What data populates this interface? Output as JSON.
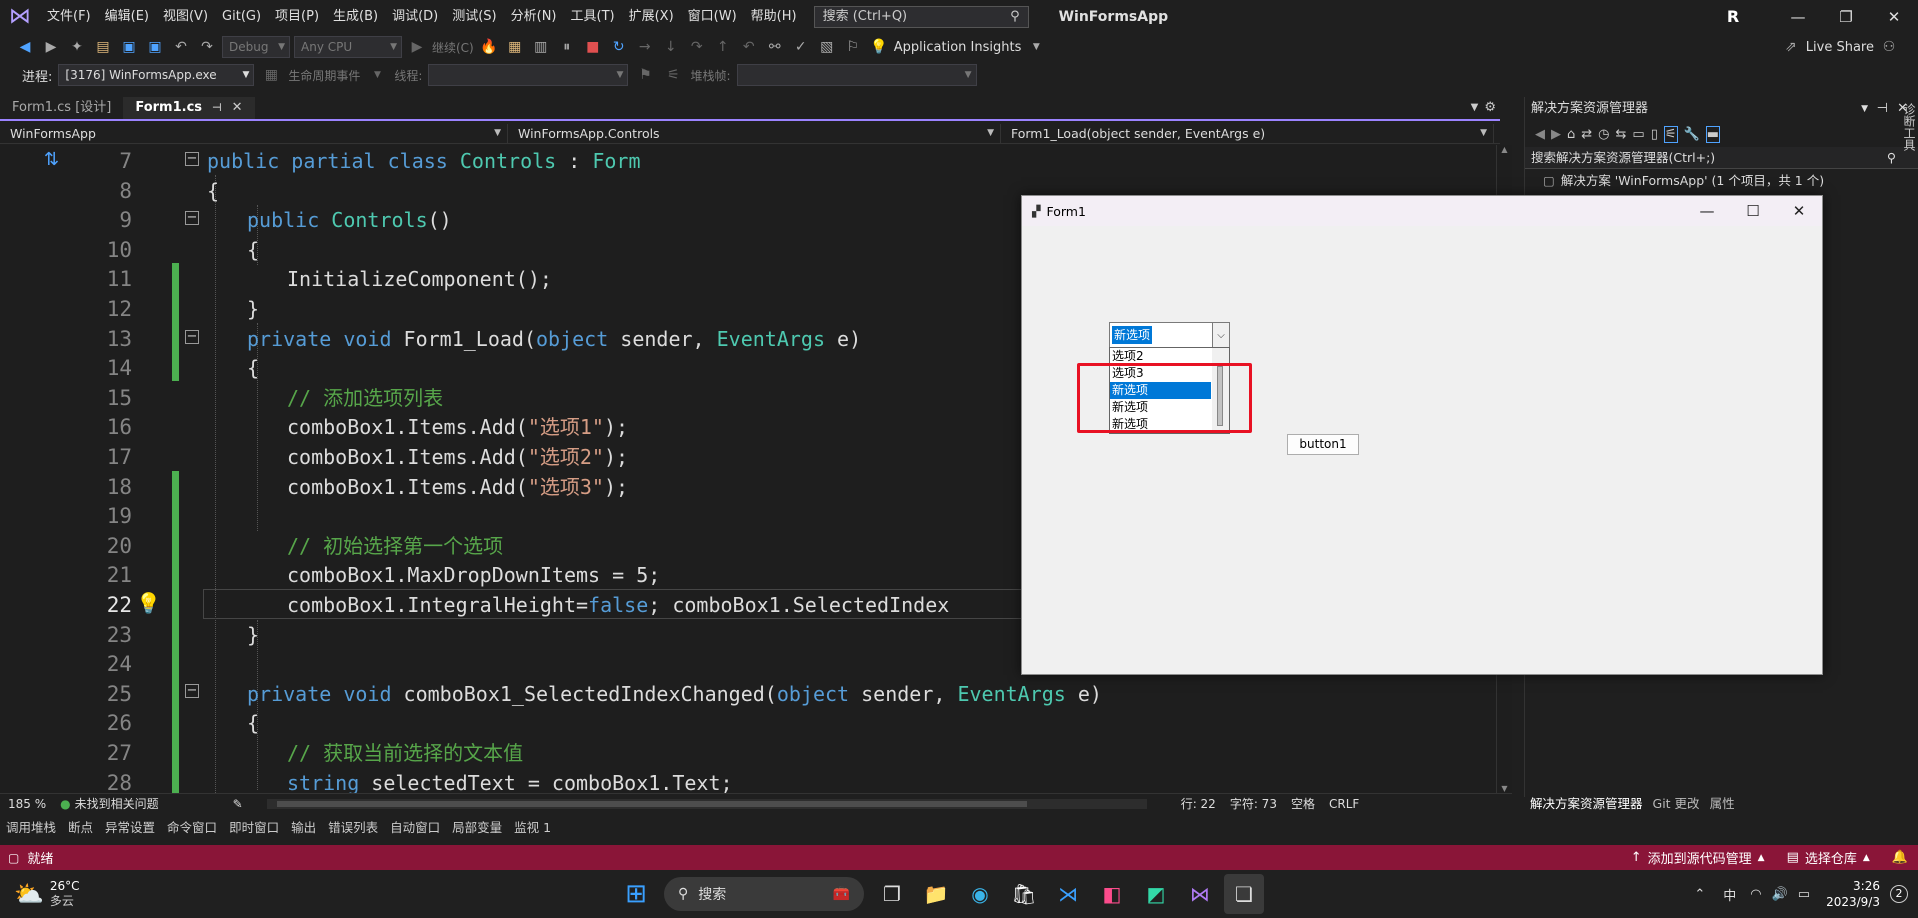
{
  "menubar": {
    "items": [
      "文件(F)",
      "编辑(E)",
      "视图(V)",
      "Git(G)",
      "项目(P)",
      "生成(B)",
      "调试(D)",
      "测试(S)",
      "分析(N)",
      "工具(T)",
      "扩展(X)",
      "窗口(W)",
      "帮助(H)"
    ],
    "search_placeholder": "搜索 (Ctrl+Q)",
    "app_title": "WinFormsApp",
    "user_initial": "R"
  },
  "toolbar1": {
    "config": "Debug",
    "platform": "Any CPU",
    "continue_label": "继续(C)",
    "app_insights": "Application Insights",
    "live_share": "Live Share"
  },
  "toolbar2": {
    "process_label": "进程:",
    "process_value": "[3176] WinFormsApp.exe",
    "lifecycle": "生命周期事件",
    "thread_label": "线程:",
    "stackframe_label": "堆栈帧:"
  },
  "tabs": [
    {
      "label": "Form1.cs [设计]"
    },
    {
      "label": "Form1.cs"
    }
  ],
  "navbar": {
    "project": "WinFormsApp",
    "class": "WinFormsApp.Controls",
    "member": "Form1_Load(object sender, EventArgs e)"
  },
  "editor": {
    "lines": [
      {
        "num": "7"
      },
      {
        "num": "8"
      },
      {
        "num": "9"
      },
      {
        "num": "10"
      },
      {
        "num": "11"
      },
      {
        "num": "12"
      },
      {
        "num": "13"
      },
      {
        "num": "14"
      },
      {
        "num": "15"
      },
      {
        "num": "16"
      },
      {
        "num": "17"
      },
      {
        "num": "18"
      },
      {
        "num": "19"
      },
      {
        "num": "20"
      },
      {
        "num": "21"
      },
      {
        "num": "22"
      },
      {
        "num": "23"
      },
      {
        "num": "24"
      },
      {
        "num": "25"
      },
      {
        "num": "26"
      },
      {
        "num": "27"
      },
      {
        "num": "28"
      }
    ],
    "code": {
      "l7": [
        "public partial class ",
        "Controls",
        " : ",
        "Form"
      ],
      "l8": "{",
      "l9": [
        "public ",
        "Controls",
        "()"
      ],
      "l10": "{",
      "l11": "InitializeComponent();",
      "l12": "}",
      "l13": [
        "private void ",
        "Form1_Load(",
        "object",
        " sender, ",
        "EventArgs",
        " e)"
      ],
      "l14": "{",
      "l15": "// 添加选项列表",
      "l16": [
        "comboBox1.Items.Add(",
        "\"选项1\"",
        ");"
      ],
      "l17": [
        "comboBox1.Items.Add(",
        "\"选项2\"",
        ");"
      ],
      "l18": [
        "comboBox1.Items.Add(",
        "\"选项3\"",
        ");"
      ],
      "l20": "// 初始选择第一个选项",
      "l21": "comboBox1.MaxDropDownItems = 5;",
      "l22": [
        "comboBox1.IntegralHeight=",
        "false",
        "; comboBox1.SelectedIndex"
      ],
      "l23": "}",
      "l25": [
        "private void ",
        "comboBox1_SelectedIndexChanged(",
        "object",
        " sender, ",
        "EventArgs",
        " e)"
      ],
      "l26": "{",
      "l27": "// 获取当前选择的文本值",
      "l28": [
        "string",
        " selectedText = comboBox1.Text;"
      ]
    }
  },
  "editor_status": {
    "zoom": "185 %",
    "issues": "未找到相关问题",
    "line": "行: 22",
    "col": "字符: 73",
    "space": "空格",
    "eol": "CRLF"
  },
  "bottom_tabs": [
    "调用堆栈",
    "断点",
    "异常设置",
    "命令窗口",
    "即时窗口",
    "输出",
    "错误列表",
    "自动窗口",
    "局部变量",
    "监视 1"
  ],
  "statusbar": {
    "ready": "就绪",
    "source_control": "添加到源代码管理",
    "repo": "选择仓库"
  },
  "solution_explorer": {
    "title": "解决方案资源管理器",
    "search": "搜索解决方案资源管理器(Ctrl+;)",
    "solution_item": "解决方案 'WinFormsApp' (1 个项目，共 1 个)",
    "bottom_tabs": [
      "解决方案资源管理器",
      "Git 更改",
      "属性"
    ],
    "side_label": "诊断工具"
  },
  "form1": {
    "title": "Form1",
    "combo_text": "新选项",
    "dropdown_items": [
      "选项2",
      "选项3",
      "新选项",
      "新选项",
      "新选项"
    ],
    "selected_index": 2,
    "button_label": "button1"
  },
  "taskbar": {
    "weather_temp": "26°C",
    "weather_desc": "多云",
    "search_label": "搜索",
    "ime": "中",
    "time": "3:26",
    "date": "2023/9/3",
    "notif_count": "2"
  }
}
